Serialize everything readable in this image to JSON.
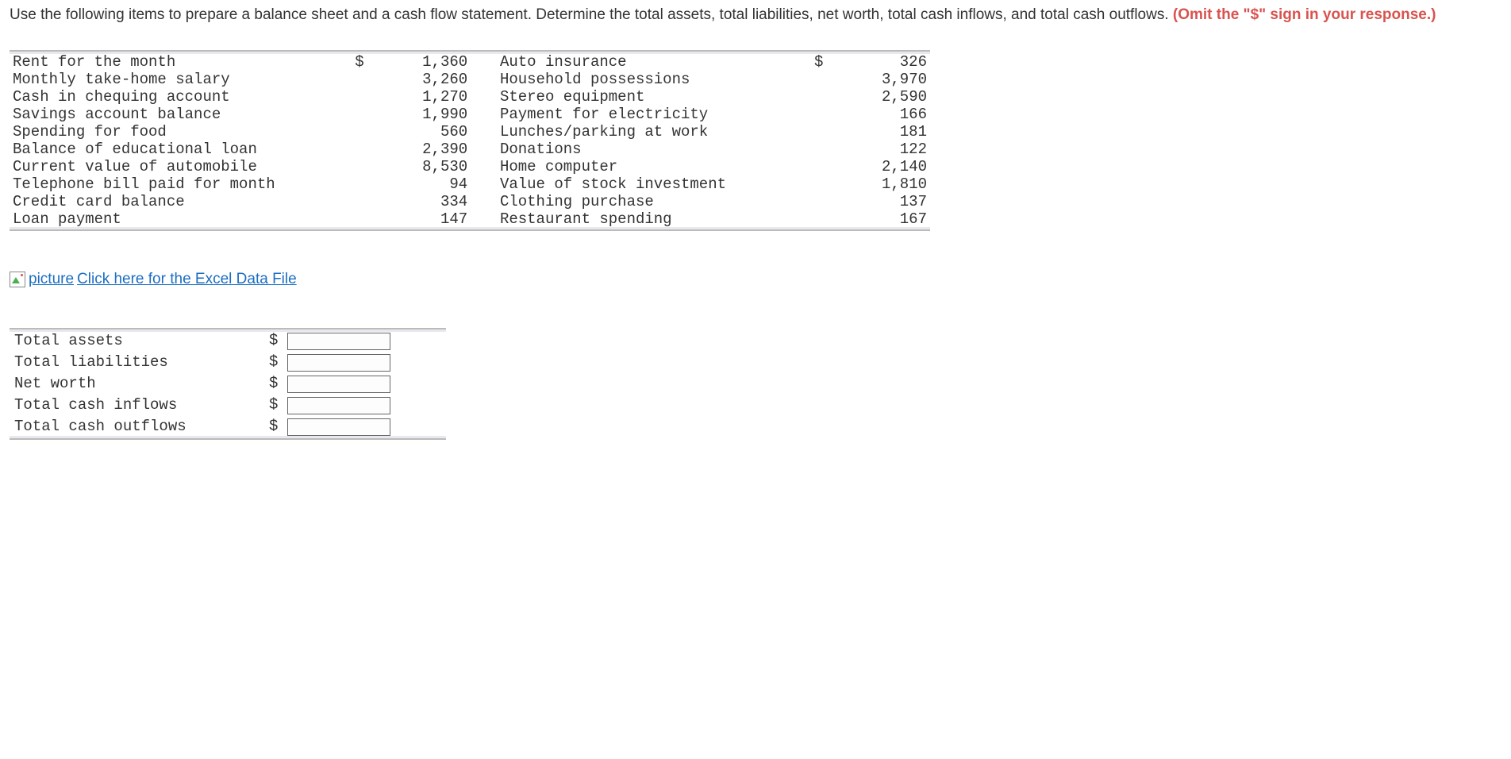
{
  "intro": {
    "text": "Use the following items to prepare a balance sheet and a cash flow statement. Determine the total assets, total liabilities, net worth, total cash inflows, and total cash outflows. ",
    "red_text": "(Omit the \"$\" sign in your response.)"
  },
  "items_left": [
    {
      "label": "Rent for the month",
      "sym": "$",
      "value": "1,360"
    },
    {
      "label": "Monthly take-home salary",
      "sym": "",
      "value": "3,260"
    },
    {
      "label": "Cash in chequing account",
      "sym": "",
      "value": "1,270"
    },
    {
      "label": "Savings account balance",
      "sym": "",
      "value": "1,990"
    },
    {
      "label": "Spending for food",
      "sym": "",
      "value": "560"
    },
    {
      "label": "Balance of educational loan",
      "sym": "",
      "value": "2,390"
    },
    {
      "label": "Current value of automobile",
      "sym": "",
      "value": "8,530"
    },
    {
      "label": "Telephone bill paid for month",
      "sym": "",
      "value": "94"
    },
    {
      "label": "Credit card balance",
      "sym": "",
      "value": "334"
    },
    {
      "label": "Loan payment",
      "sym": "",
      "value": "147"
    }
  ],
  "items_right": [
    {
      "label": "Auto insurance",
      "sym": "$",
      "value": "326"
    },
    {
      "label": "Household possessions",
      "sym": "",
      "value": "3,970"
    },
    {
      "label": "Stereo equipment",
      "sym": "",
      "value": "2,590"
    },
    {
      "label": "Payment for electricity",
      "sym": "",
      "value": "166"
    },
    {
      "label": "Lunches/parking at work",
      "sym": "",
      "value": "181"
    },
    {
      "label": "Donations",
      "sym": "",
      "value": "122"
    },
    {
      "label": "Home computer",
      "sym": "",
      "value": "2,140"
    },
    {
      "label": "Value of stock investment",
      "sym": "",
      "value": "1,810"
    },
    {
      "label": "Clothing purchase",
      "sym": "",
      "value": "137"
    },
    {
      "label": "Restaurant spending",
      "sym": "",
      "value": "167"
    }
  ],
  "excel_link": {
    "prefix": "picture",
    "text": "Click here for the Excel Data File"
  },
  "answers": [
    {
      "label": "Total assets",
      "sym": "$",
      "value": ""
    },
    {
      "label": "Total liabilities",
      "sym": "$",
      "value": ""
    },
    {
      "label": "Net worth",
      "sym": "$",
      "value": ""
    },
    {
      "label": "Total cash inflows",
      "sym": "$",
      "value": ""
    },
    {
      "label": "Total cash outflows",
      "sym": "$",
      "value": ""
    }
  ]
}
